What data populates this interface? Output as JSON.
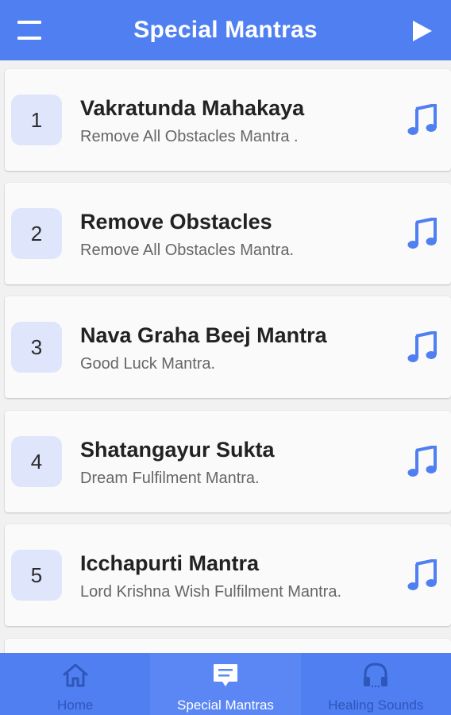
{
  "header": {
    "title": "Special Mantras",
    "menu_icon": "menu-icon",
    "play_icon": "play-icon",
    "accent_color": "#4f7ff1"
  },
  "mantras": [
    {
      "number": "1",
      "title": "Vakratunda Mahakaya",
      "subtitle": "Remove All Obstacles Mantra ."
    },
    {
      "number": "2",
      "title": "Remove Obstacles",
      "subtitle": "Remove All Obstacles Mantra."
    },
    {
      "number": "3",
      "title": "Nava Graha Beej Mantra",
      "subtitle": "Good Luck Mantra."
    },
    {
      "number": "4",
      "title": "Shatangayur Sukta",
      "subtitle": "Dream Fulfilment Mantra."
    },
    {
      "number": "5",
      "title": "Icchapurti Mantra",
      "subtitle": "Lord Krishna Wish Fulfilment Mantra."
    }
  ],
  "bottom_nav": {
    "items": [
      {
        "label": "Home",
        "icon": "home-icon",
        "active": false
      },
      {
        "label": "Special Mantras",
        "icon": "message-icon",
        "active": true
      },
      {
        "label": "Healing Sounds",
        "icon": "headphones-icon",
        "active": false
      }
    ]
  }
}
